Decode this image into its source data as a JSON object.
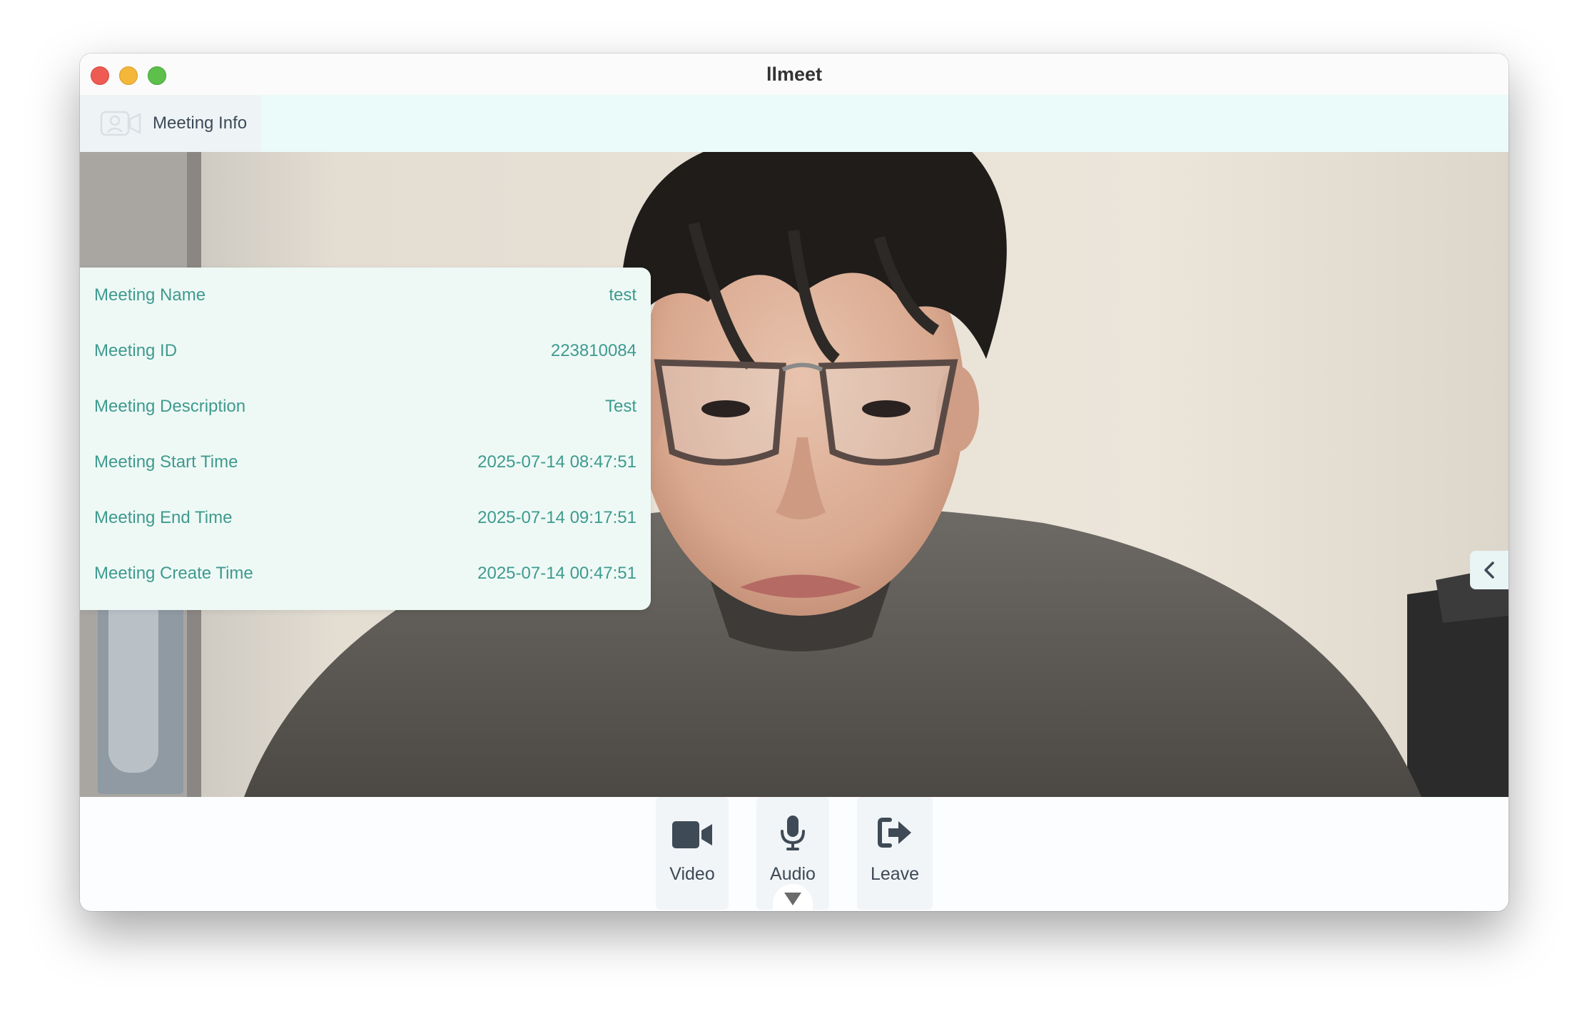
{
  "window": {
    "title": "llmeet"
  },
  "toolbar": {
    "meeting_info_tab": {
      "label": "Meeting Info",
      "icon": "video-chat-icon"
    }
  },
  "meeting_info": {
    "rows": [
      {
        "label": "Meeting Name",
        "value": "test"
      },
      {
        "label": "Meeting ID",
        "value": "223810084"
      },
      {
        "label": "Meeting Description",
        "value": "Test"
      },
      {
        "label": "Meeting Start Time",
        "value": "2025-07-14 08:47:51"
      },
      {
        "label": "Meeting End Time",
        "value": "2025-07-14 09:17:51"
      },
      {
        "label": "Meeting Create Time",
        "value": "2025-07-14 00:47:51"
      }
    ]
  },
  "controls": {
    "video": {
      "label": "Video",
      "icon": "video-camera-icon"
    },
    "audio": {
      "label": "Audio",
      "icon": "microphone-icon",
      "menu_icon": "chevron-down-icon"
    },
    "leave": {
      "label": "Leave",
      "icon": "leave-icon"
    }
  },
  "side_toggle": {
    "icon": "chevron-left-icon"
  },
  "colors": {
    "accent_text": "#3f9a8e",
    "panel_bg": "#eef9f6",
    "subbar_bg": "#ebfbfa",
    "control_icon": "#3e4a56"
  }
}
